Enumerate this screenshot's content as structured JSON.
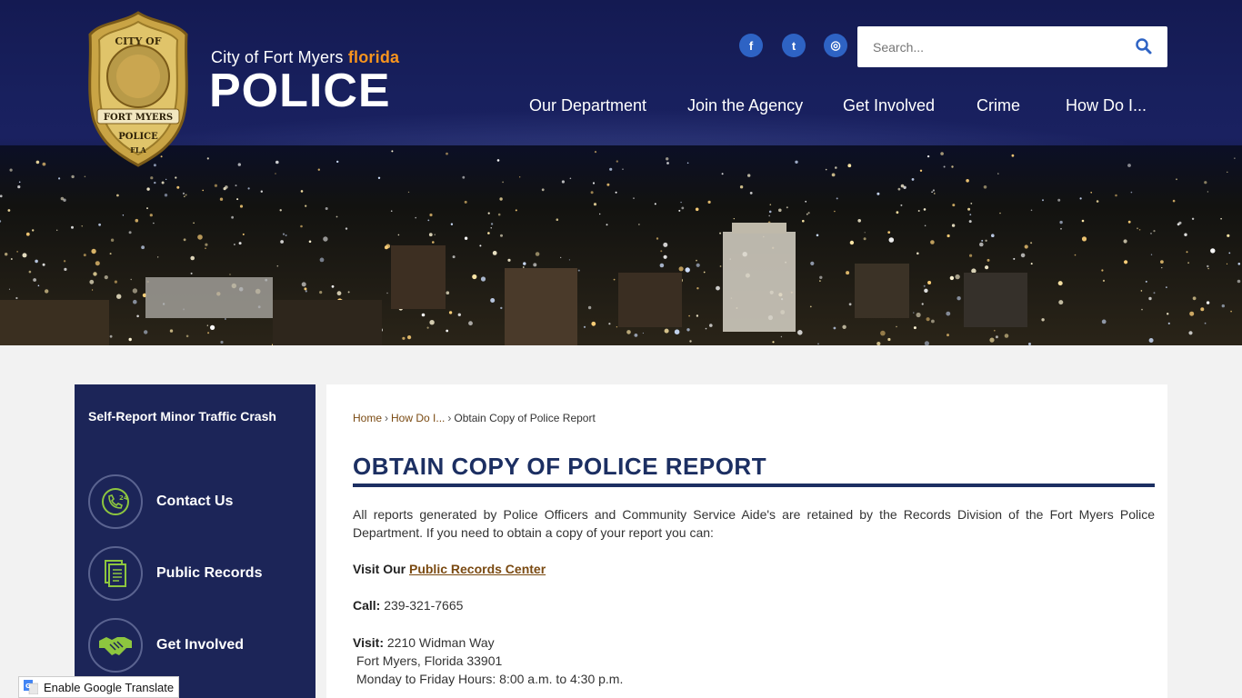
{
  "header": {
    "brand_sub_prefix": "City of Fort Myers",
    "brand_sub_highlight": "florida",
    "brand_main": "POLICE",
    "badge_text_top": "CITY OF",
    "badge_text_mid": "FORT MYERS",
    "badge_text_bottom": "POLICE",
    "badge_text_state": "FLA"
  },
  "social": [
    {
      "name": "facebook-icon",
      "glyph": "f"
    },
    {
      "name": "twitter-icon",
      "glyph": "t"
    },
    {
      "name": "instagram-icon",
      "glyph": "◎"
    }
  ],
  "search": {
    "placeholder": "Search..."
  },
  "nav": [
    {
      "label": "Our Department"
    },
    {
      "label": "Join the Agency"
    },
    {
      "label": "Get Involved"
    },
    {
      "label": "Crime"
    },
    {
      "label": "How Do I..."
    }
  ],
  "sidebar": {
    "top_link": "Self-Report Minor Traffic Crash",
    "items": [
      {
        "label": "Contact Us",
        "icon": "phone-24-icon"
      },
      {
        "label": "Public Records",
        "icon": "document-icon"
      },
      {
        "label": "Get Involved",
        "icon": "handshake-icon"
      }
    ],
    "accent": "#8dc63f"
  },
  "breadcrumb": {
    "home": "Home",
    "section": "How Do I...",
    "current": "Obtain Copy of Police Report",
    "separator": "›"
  },
  "page": {
    "title": "OBTAIN COPY OF POLICE REPORT",
    "intro": "All reports generated by Police Officers and Community Service Aide's are retained by the Records Division of the Fort Myers Police Department.  If you need to obtain a copy of your report you can:",
    "visit_our_label": "Visit Our",
    "visit_our_link": "Public Records Center",
    "call_label": "Call:",
    "call_value": "239-321-7665",
    "visit_label": "Visit:",
    "address_line1": "2210 Widman Way",
    "address_line2": "Fort Myers, Florida 33901",
    "hours": "Monday to Friday Hours:  8:00 a.m. to 4:30 p.m."
  },
  "translate": {
    "label": "Enable Google Translate"
  },
  "colors": {
    "navy": "#1c2558",
    "title": "#1c2f62",
    "link_brown": "#7a4a12",
    "orange": "#f7941e",
    "social_blue": "#2e63c4"
  }
}
